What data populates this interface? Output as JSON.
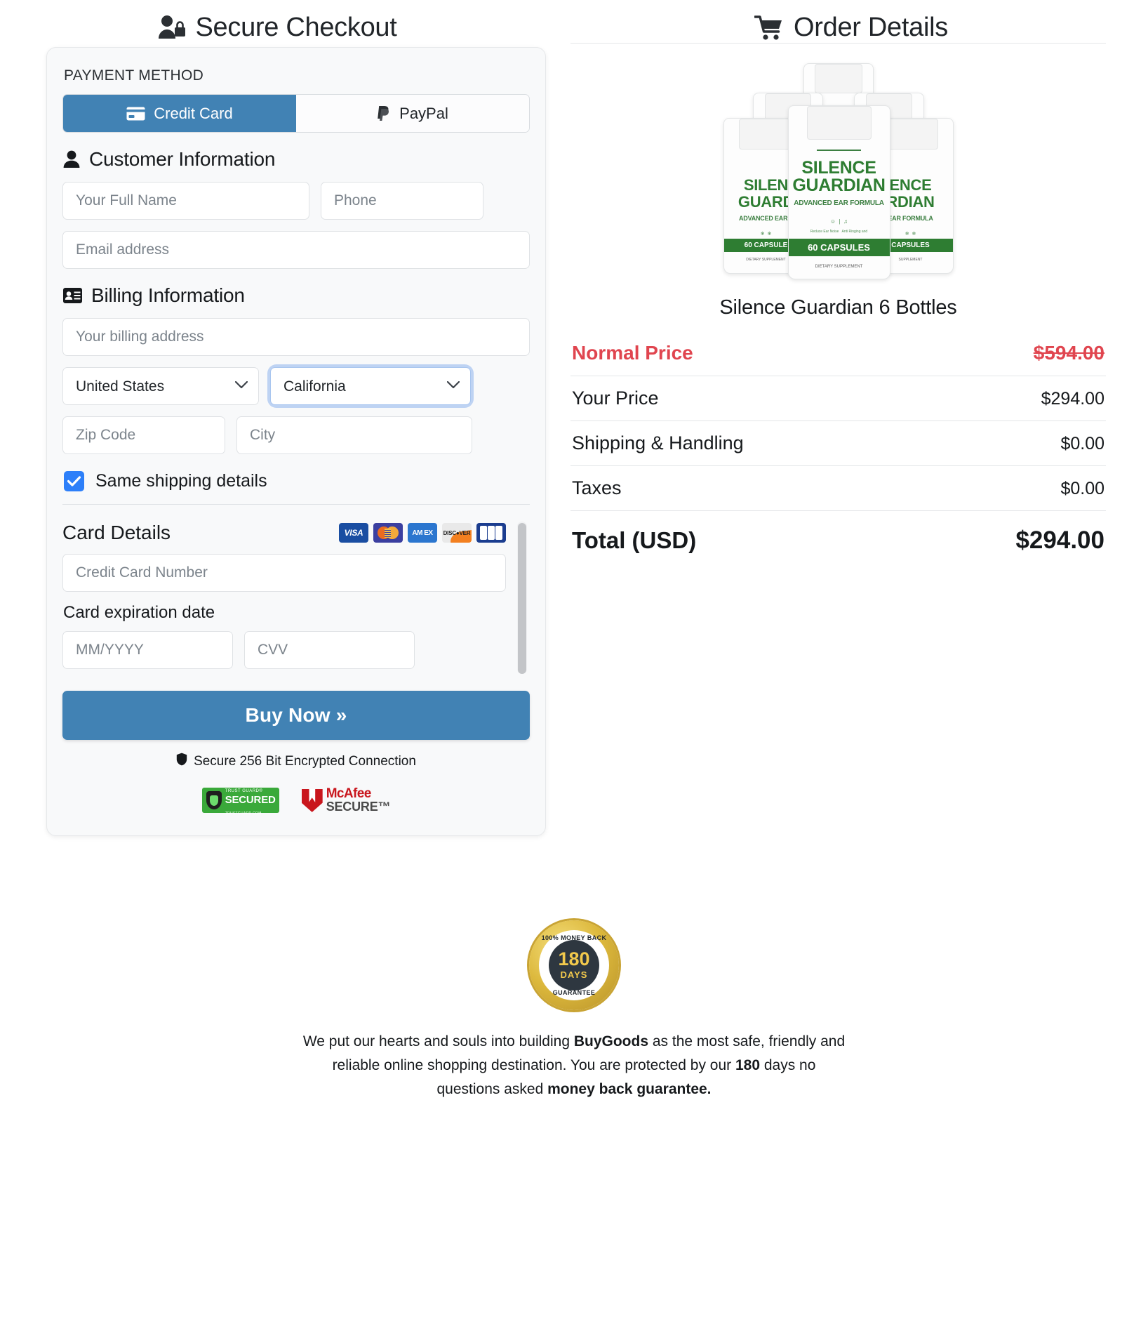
{
  "headers": {
    "checkout": "Secure Checkout",
    "order": "Order Details"
  },
  "payment": {
    "section_label": "PAYMENT METHOD",
    "methods": [
      {
        "label": "Credit Card",
        "icon": "credit-card-icon",
        "active": true
      },
      {
        "label": "PayPal",
        "icon": "paypal-icon",
        "active": false
      }
    ]
  },
  "customer": {
    "title": "Customer Information",
    "name_placeholder": "Your Full Name",
    "phone_placeholder": "Phone",
    "email_placeholder": "Email address"
  },
  "billing": {
    "title": "Billing Information",
    "address_placeholder": "Your billing address",
    "country_value": "United States",
    "state_value": "California",
    "zip_placeholder": "Zip Code",
    "city_placeholder": "City",
    "same_shipping_label": "Same shipping details",
    "same_shipping_checked": true
  },
  "card": {
    "title": "Card Details",
    "accepted": [
      "VISA",
      "Mastercard",
      "AMEX",
      "DISCOVER",
      "JCB"
    ],
    "number_placeholder": "Credit Card Number",
    "expiration_label": "Card expiration date",
    "expiration_placeholder": "MM/YYYY",
    "cvv_placeholder": "CVV"
  },
  "cta": {
    "buy_label": "Buy Now »",
    "secure_note": "Secure 256 Bit Encrypted Connection",
    "badges": [
      {
        "name": "trust-guard",
        "top": "TRUST GUARD®",
        "mid": "SECURED",
        "bottom": "TRUSTGUARD.COM"
      },
      {
        "name": "mcafee",
        "line1": "McAfee",
        "line2": "SECURE™"
      }
    ]
  },
  "order": {
    "product_name": "Silence Guardian 6 Bottles",
    "bottle_label": {
      "name_line1": "SILENCE",
      "name_line2": "GUARDIAN",
      "subtitle": "ADVANCED EAR FORMULA",
      "capsules": "60 CAPSULES",
      "supplement": "DIETARY SUPPLEMENT",
      "benefit1": "Reduce Ear Noise Sensitivity",
      "benefit2": "Anti Ringing and Buzzing"
    },
    "rows": [
      {
        "label": "Normal Price",
        "value": "$594.00",
        "style": "normal"
      },
      {
        "label": "Your Price",
        "value": "$294.00",
        "style": "plain"
      },
      {
        "label": "Shipping & Handling",
        "value": "$0.00",
        "style": "plain"
      },
      {
        "label": "Taxes",
        "value": "$0.00",
        "style": "plain"
      },
      {
        "label": "Total (USD)",
        "value": "$294.00",
        "style": "total"
      }
    ]
  },
  "guarantee": {
    "seal_top": "100% MONEY BACK",
    "seal_days_number": "180",
    "seal_days_word": "DAYS",
    "seal_bottom": "GUARANTEE",
    "text_part1": "We put our hearts and souls into building ",
    "text_brand": "BuyGoods",
    "text_part2": " as the most safe, friendly and reliable online shopping destination. You are protected by our ",
    "text_days": "180",
    "text_part3": " days no questions asked ",
    "text_bold_end": "money back guarantee."
  },
  "colors": {
    "primary_blue": "#4182b4",
    "checkbox_blue": "#2d7ff9",
    "sale_red": "#e0454f",
    "panel_bg": "#f8f9fa"
  }
}
